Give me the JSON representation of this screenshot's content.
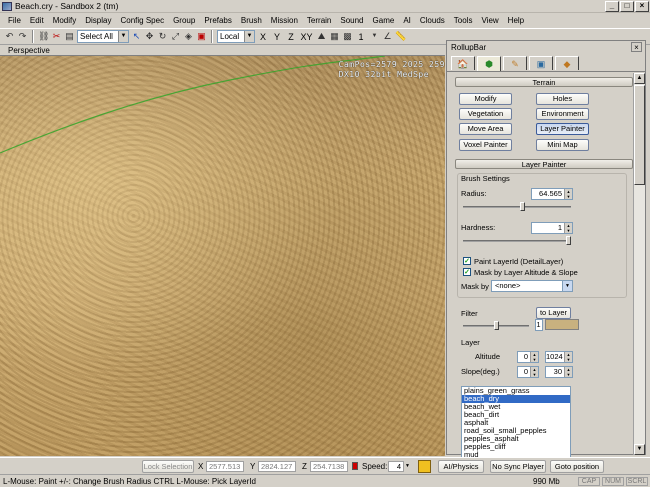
{
  "window": {
    "title": "Beach.cry - Sandbox 2 (tm)"
  },
  "menu": [
    "File",
    "Edit",
    "Modify",
    "Display",
    "Config Spec",
    "Group",
    "Prefabs",
    "Brush",
    "Mission",
    "Terrain",
    "Sound",
    "Game",
    "AI",
    "Clouds",
    "Tools",
    "View",
    "Help"
  ],
  "toolbar": {
    "selection_combo": "Select All",
    "coord_system_combo": "Local",
    "axis_labels": [
      "X",
      "Y",
      "Z",
      "XY"
    ],
    "layer_combo": "1"
  },
  "viewport": {
    "label": "Perspective",
    "campos_line": "CamPos=2579 2025 259",
    "renderer_line": "DX10 32bit MedSpe"
  },
  "rollup": {
    "title": "RollupBar",
    "tabs": [
      {
        "icon": "objects-icon"
      },
      {
        "icon": "terrain-icon"
      },
      {
        "icon": "modelling-icon"
      },
      {
        "icon": "display-icon"
      },
      {
        "icon": "layers-icon"
      }
    ],
    "terrain_header": "Terrain",
    "terrain_buttons": [
      "Modify",
      "Holes",
      "Vegetation",
      "Environment",
      "Move Area",
      "Layer Painter",
      "Voxel Painter",
      "Mini Map"
    ],
    "active_button": "Layer Painter",
    "layer_painter_header": "Layer Painter",
    "brush_settings_label": "Brush Settings",
    "radius_label": "Radius:",
    "radius_value": "64.565",
    "radius_fraction": 0.55,
    "hardness_label": "Hardness:",
    "hardness_value": "1",
    "hardness_fraction": 1.0,
    "paint_layer_label": "Paint LayerId (DetailLayer)",
    "paint_layer_checked": true,
    "mask_altitude_label": "Mask by Layer Altitude & Slope",
    "mask_altitude_checked": true,
    "mask_by_label": "Mask by",
    "mask_by_value": "<none>",
    "filter_label": "Filter",
    "filter_value": "1",
    "filter_fraction": 0.5,
    "to_layer_button": "to Layer",
    "filter_color": "#c8b17f",
    "layer_label": "Layer",
    "altitude_label": "Altitude",
    "altitude_min": "0",
    "altitude_max": "1024",
    "slope_label": "Slope(deg.)",
    "slope_min": "0",
    "slope_max": "30",
    "layers": [
      "plains_green_grass",
      "beach_dry",
      "beach_wet",
      "beach_dirt",
      "asphalt",
      "road_soil_small_pepples",
      "pepples_asphalt",
      "pepples_cliff",
      "mud"
    ],
    "selected_layer": "beach_dry"
  },
  "bottom": {
    "lock_selection": "Lock Selection",
    "x_label": "X",
    "x_value": "2577.513",
    "y_label": "Y",
    "y_value": "2824.127",
    "z_label": "Z",
    "z_value": "254.7138",
    "speed_label": "Speed:",
    "speed_value": "4",
    "ai_physics": "AI/Physics",
    "no_sync_player": "No Sync Player",
    "goto_position": "Goto position"
  },
  "status": {
    "hint": "L-Mouse: Paint   +/-: Change Brush Radius   CTRL L-Mouse: Pick LayerId",
    "memory": "990 Mb",
    "indicators": [
      "CAP",
      "NUM",
      "SCRL"
    ]
  },
  "colors": {
    "selection_blue": "#316ac5",
    "path_green": "#35a52a"
  }
}
